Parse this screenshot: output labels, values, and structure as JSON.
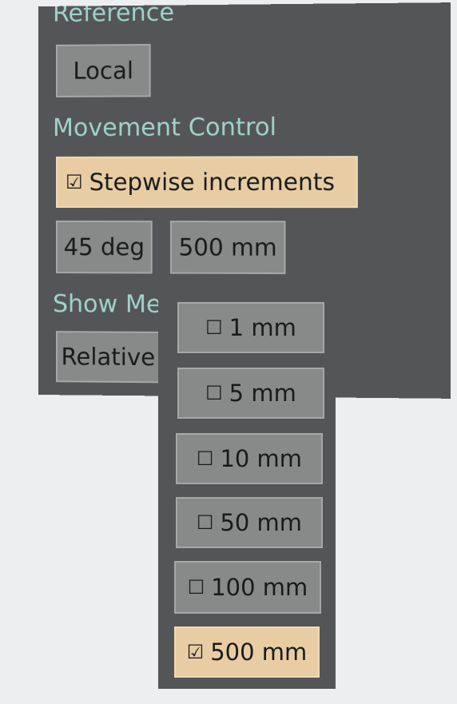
{
  "reference": {
    "heading": "Reference",
    "button_label": "Local"
  },
  "movement_control": {
    "heading": "Movement Control",
    "stepwise_checkbox": {
      "glyph": "☑",
      "label": "Stepwise increments",
      "checked": true
    },
    "angle_button": "45 deg",
    "distance_button": "500 mm"
  },
  "show_measurements": {
    "heading": "Show Me",
    "button_label": "Relative"
  },
  "distance_dropdown": {
    "options": [
      {
        "glyph": "☐",
        "label": "1 mm",
        "checked": false
      },
      {
        "glyph": "☐",
        "label": "5 mm",
        "checked": false
      },
      {
        "glyph": "☐",
        "label": "10 mm",
        "checked": false
      },
      {
        "glyph": "☐",
        "label": "50 mm",
        "checked": false
      },
      {
        "glyph": "☐",
        "label": "100 mm",
        "checked": false
      },
      {
        "glyph": "☑",
        "label": "500 mm",
        "checked": true
      }
    ]
  },
  "colors": {
    "panel_bg": "#545556",
    "heading_text": "#9fd3c9",
    "button_bg": "#888989",
    "active_bg": "#e8cda4",
    "page_bg": "#eceef0"
  }
}
